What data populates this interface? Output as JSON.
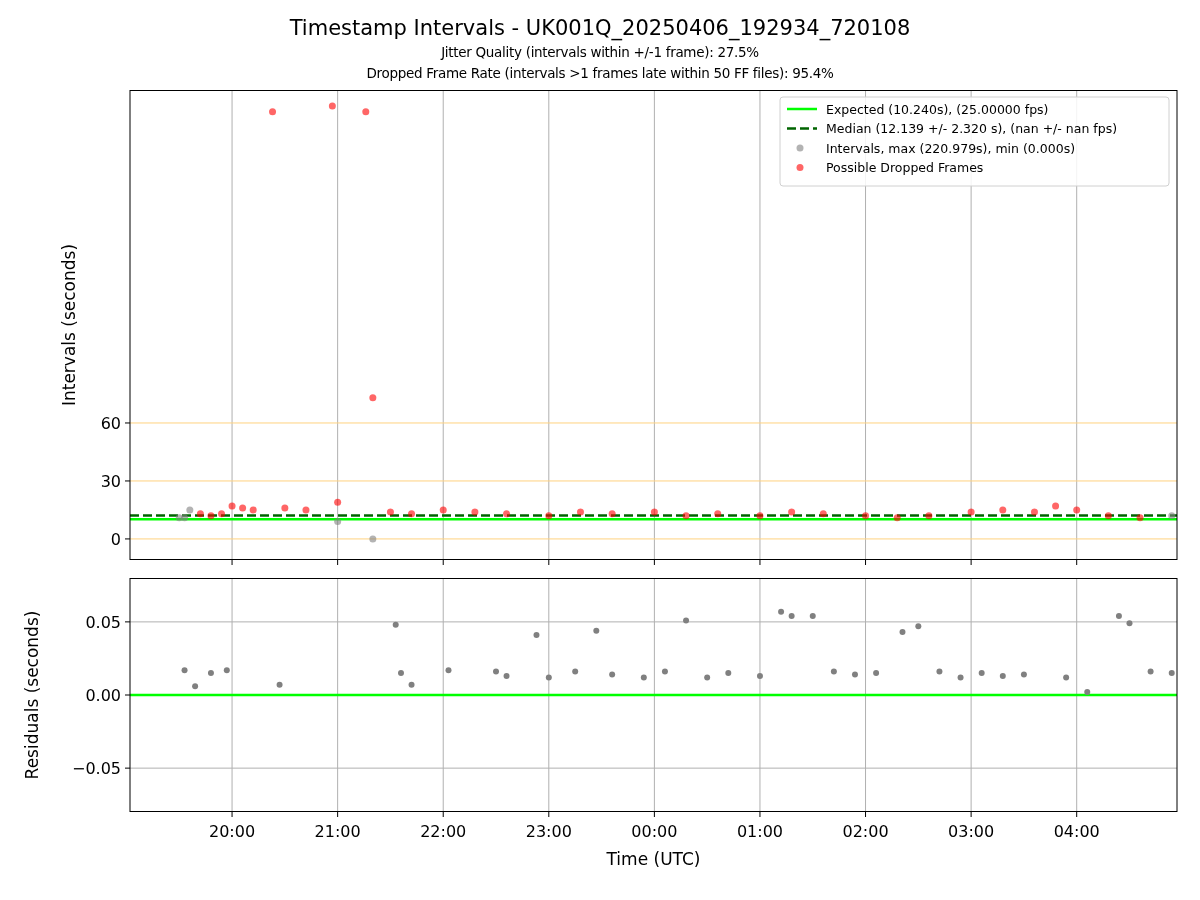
{
  "figure": {
    "title": "Timestamp Intervals - UK001Q_20250406_192934_720108",
    "subtitles": [
      "Jitter Quality (intervals within +/-1 frame): 27.5%",
      "Dropped Frame Rate (intervals >1 frames late within 50 FF files): 95.4%"
    ]
  },
  "intervals_plot": {
    "chart_data": {
      "type": "scatter",
      "ylabel": "Intervals (seconds)",
      "xlim": [
        "2025-04-06T19:02",
        "2025-04-07T04:57"
      ],
      "ylim": [
        -10.9,
        232.3
      ],
      "yticks": [
        0,
        30,
        60
      ],
      "grid": true,
      "legend": true,
      "ref_lines": [
        {
          "axis": "y",
          "value": 10.24,
          "label": "Expected (10.240s), (25.00000 fps)",
          "color": "#00ff00"
        },
        {
          "axis": "y",
          "value": 12.139,
          "label": "Median (12.139 +/- 2.320 s), (nan +/- nan fps)",
          "color": "#006400"
        }
      ],
      "x": [
        "2025-04-06T19:30",
        "2025-04-06T19:33",
        "2025-04-06T19:36",
        "2025-04-06T19:42",
        "2025-04-06T19:48",
        "2025-04-06T19:54",
        "2025-04-06T20:00",
        "2025-04-06T20:06",
        "2025-04-06T20:12",
        "2025-04-06T20:23",
        "2025-04-06T20:30",
        "2025-04-06T20:42",
        "2025-04-06T20:57",
        "2025-04-06T21:00",
        "2025-04-06T21:16",
        "2025-04-06T21:20",
        "2025-04-06T21:30",
        "2025-04-06T21:42",
        "2025-04-06T22:00",
        "2025-04-06T22:18",
        "2025-04-06T22:36",
        "2025-04-06T23:00",
        "2025-04-06T23:18",
        "2025-04-06T23:36",
        "2025-04-07T00:00",
        "2025-04-07T00:18",
        "2025-04-07T00:36",
        "2025-04-07T01:00",
        "2025-04-07T01:18",
        "2025-04-07T01:36",
        "2025-04-07T02:00",
        "2025-04-07T02:18",
        "2025-04-07T02:36",
        "2025-04-07T03:00",
        "2025-04-07T03:18",
        "2025-04-07T03:36",
        "2025-04-07T03:48",
        "2025-04-07T04:00",
        "2025-04-07T04:18",
        "2025-04-07T04:36",
        "2025-04-07T04:54"
      ],
      "series": [
        {
          "name": "Intervals, max (220.979s), min (0.000s)",
          "color": "#808080",
          "values": [
            11,
            11,
            15,
            null,
            null,
            null,
            null,
            null,
            null,
            null,
            null,
            null,
            null,
            9,
            null,
            0,
            null,
            null,
            null,
            null,
            null,
            null,
            null,
            null,
            null,
            null,
            null,
            null,
            null,
            null,
            null,
            null,
            null,
            null,
            null,
            null,
            null,
            null,
            null,
            null,
            12
          ]
        },
        {
          "name": "Possible Dropped Frames",
          "color": "#ff0000",
          "values": [
            null,
            null,
            null,
            13,
            12,
            13,
            17,
            16,
            15,
            221,
            16,
            15,
            224,
            19,
            221,
            73,
            14,
            13,
            15,
            14,
            13,
            12,
            14,
            13,
            14,
            12,
            13,
            12,
            14,
            13,
            12,
            11,
            12,
            14,
            15,
            14,
            17,
            15,
            12,
            11,
            null
          ]
        }
      ]
    }
  },
  "residuals_plot": {
    "chart_data": {
      "type": "scatter",
      "xlabel": "Time (UTC)",
      "ylabel": "Residuals (seconds)",
      "xlim": [
        "2025-04-06T19:02",
        "2025-04-07T04:57"
      ],
      "ylim": [
        -0.08,
        0.08
      ],
      "grid": true,
      "xticks": [
        {
          "value": "2025-04-06T20:00",
          "label": "20:00"
        },
        {
          "value": "2025-04-06T21:00",
          "label": "21:00"
        },
        {
          "value": "2025-04-06T22:00",
          "label": "22:00"
        },
        {
          "value": "2025-04-06T23:00",
          "label": "23:00"
        },
        {
          "value": "2025-04-07T00:00",
          "label": "00:00"
        },
        {
          "value": "2025-04-07T01:00",
          "label": "01:00"
        },
        {
          "value": "2025-04-07T02:00",
          "label": "02:00"
        },
        {
          "value": "2025-04-07T03:00",
          "label": "03:00"
        },
        {
          "value": "2025-04-07T04:00",
          "label": "04:00"
        }
      ],
      "yticks": [
        {
          "value": -0.05,
          "label": "−0.05"
        },
        {
          "value": 0,
          "label": "0.00"
        },
        {
          "value": 0.05,
          "label": "0.05"
        }
      ],
      "ref_lines": [
        {
          "axis": "y",
          "value": 0,
          "color": "#00ff00"
        }
      ],
      "x": [
        "2025-04-06T19:33",
        "2025-04-06T19:39",
        "2025-04-06T19:48",
        "2025-04-06T19:57",
        "2025-04-06T20:27",
        "2025-04-06T21:33",
        "2025-04-06T21:36",
        "2025-04-06T21:42",
        "2025-04-06T22:03",
        "2025-04-06T22:30",
        "2025-04-06T22:36",
        "2025-04-06T22:53",
        "2025-04-06T23:00",
        "2025-04-06T23:15",
        "2025-04-06T23:27",
        "2025-04-06T23:36",
        "2025-04-06T23:54",
        "2025-04-07T00:06",
        "2025-04-07T00:18",
        "2025-04-07T00:30",
        "2025-04-07T00:42",
        "2025-04-07T01:00",
        "2025-04-07T01:12",
        "2025-04-07T01:18",
        "2025-04-07T01:30",
        "2025-04-07T01:42",
        "2025-04-07T01:54",
        "2025-04-07T02:06",
        "2025-04-07T02:21",
        "2025-04-07T02:30",
        "2025-04-07T02:42",
        "2025-04-07T02:54",
        "2025-04-07T03:06",
        "2025-04-07T03:18",
        "2025-04-07T03:30",
        "2025-04-07T03:54",
        "2025-04-07T04:06",
        "2025-04-07T04:24",
        "2025-04-07T04:30",
        "2025-04-07T04:42",
        "2025-04-07T04:54"
      ],
      "series": [
        {
          "color": "#808080",
          "values": [
            0.017,
            0.006,
            0.015,
            0.017,
            0.007,
            0.048,
            0.015,
            0.007,
            0.017,
            0.016,
            0.013,
            0.041,
            0.012,
            0.016,
            0.044,
            0.014,
            0.012,
            0.016,
            0.051,
            0.012,
            0.015,
            0.013,
            0.057,
            0.054,
            0.054,
            0.016,
            0.014,
            0.015,
            0.043,
            0.047,
            0.016,
            0.012,
            0.015,
            0.013,
            0.014,
            0.012,
            0.002,
            0.054,
            0.049,
            0.016,
            0.015
          ]
        }
      ]
    }
  }
}
